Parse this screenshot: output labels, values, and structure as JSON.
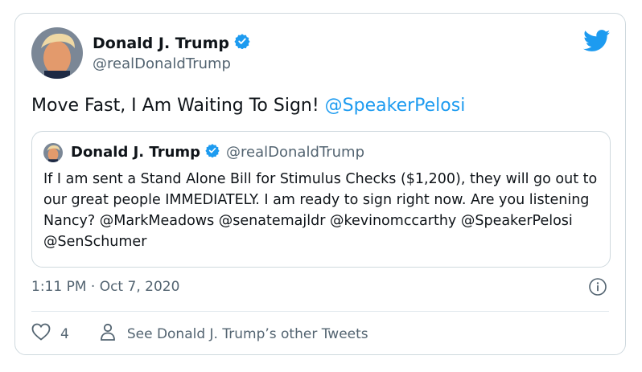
{
  "author": {
    "name": "Donald J. Trump",
    "handle": "@realDonaldTrump",
    "verified": true
  },
  "tweet": {
    "text_main": "Move Fast, I Am Waiting To Sign! ",
    "mention": "@SpeakerPelosi",
    "timestamp": "1:11 PM · Oct 7, 2020",
    "like_count": "4",
    "see_other": "See Donald J. Trump’s other Tweets"
  },
  "quoted": {
    "name": "Donald J. Trump",
    "handle": "@realDonaldTrump",
    "text": "If I am sent a Stand Alone Bill for Stimulus Checks ($1,200), they will go out to our great people IMMEDIATELY. I am ready to sign right now. Are you listening Nancy? @MarkMeadows @senatemajldr @kevinomccarthy @SpeakerPelosi @SenSchumer"
  },
  "colors": {
    "accent": "#1d9bf0",
    "text": "#0f1419",
    "muted": "#536471",
    "border": "#cfd9de"
  },
  "icons": [
    "twitter-bird-icon",
    "verified-badge-icon",
    "info-icon",
    "heart-icon",
    "person-icon"
  ]
}
